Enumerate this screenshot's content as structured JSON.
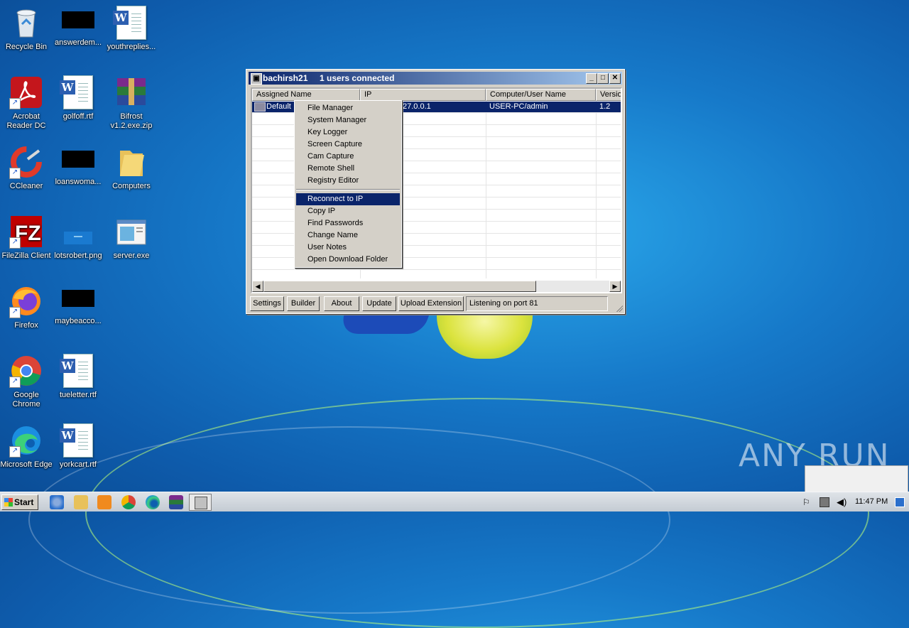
{
  "desktop": {
    "icons": [
      {
        "label": "Recycle Bin"
      },
      {
        "label": "answerdem..."
      },
      {
        "label": "youthreplies..."
      },
      {
        "label": "Acrobat Reader DC"
      },
      {
        "label": "golfoff.rtf"
      },
      {
        "label": "Bifrost v1.2.exe.zip"
      },
      {
        "label": "CCleaner"
      },
      {
        "label": "loanswoma..."
      },
      {
        "label": "Computers"
      },
      {
        "label": "FileZilla Client"
      },
      {
        "label": "lotsrobert.png"
      },
      {
        "label": "server.exe"
      },
      {
        "label": "Firefox"
      },
      {
        "label": "maybeacco..."
      },
      {
        "label": "Google Chrome"
      },
      {
        "label": "tueletter.rtf"
      },
      {
        "label": "Microsoft Edge"
      },
      {
        "label": "yorkcart.rtf"
      }
    ]
  },
  "window": {
    "title": "bachirsh21",
    "connected": "1 users connected",
    "columns": [
      "Assigned Name",
      "IP",
      "Computer/User Name",
      "Versio"
    ],
    "row": {
      "name": "Default",
      "ip": "27.0.0.1",
      "user": "USER-PC/admin",
      "version": "1.2"
    },
    "buttons": {
      "settings": "Settings",
      "builder": "Builder",
      "about": "About",
      "update": "Update",
      "upload": "Upload Extension"
    },
    "status": "Listening on port 81"
  },
  "context_menu": {
    "group1": [
      "File Manager",
      "System Manager",
      "Key Logger",
      "Screen Capture",
      "Cam Capture",
      "Remote Shell",
      "Registry Editor"
    ],
    "group2": [
      "Reconnect to IP",
      "Copy IP",
      "Find Passwords",
      "Change Name",
      "User Notes",
      "Open Download Folder"
    ],
    "selected": "Reconnect to IP"
  },
  "taskbar": {
    "start_label": "Start",
    "clock": "11:47 PM"
  },
  "watermark": "ANY RUN"
}
